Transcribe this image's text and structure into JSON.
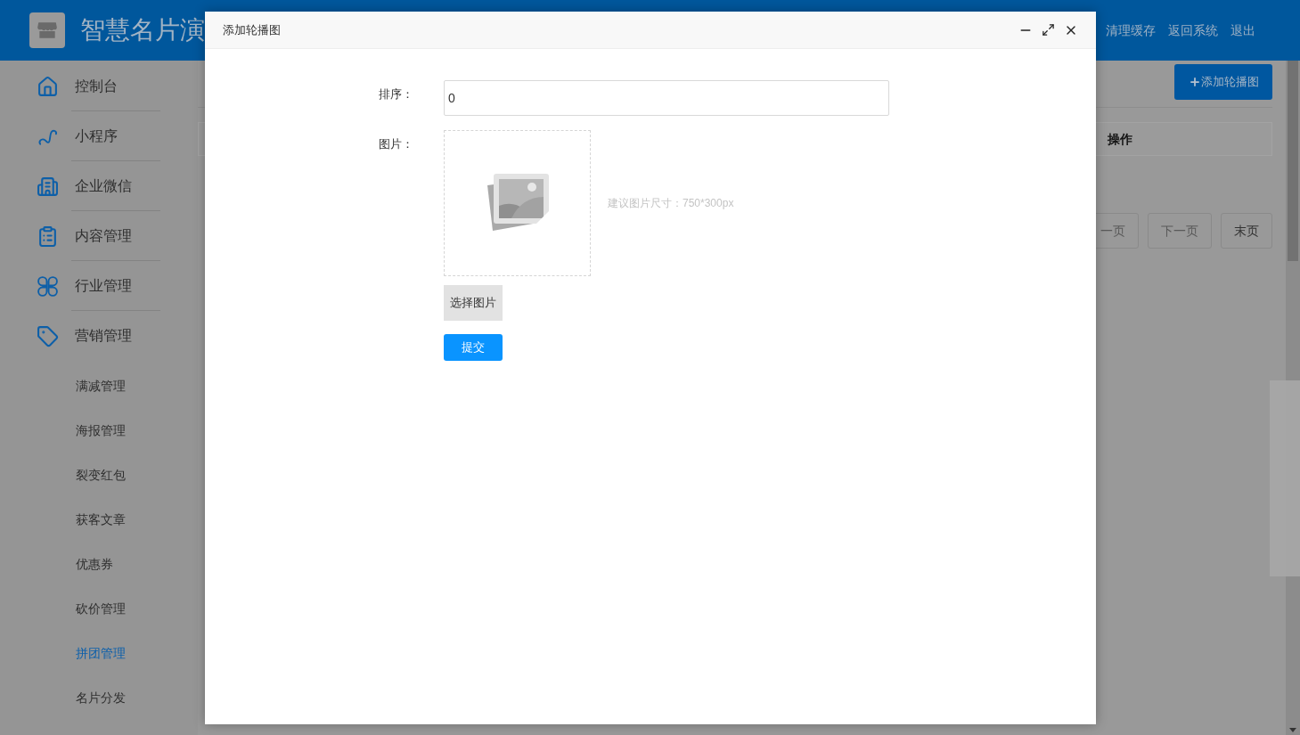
{
  "header": {
    "title": "智慧名片演",
    "links": [
      "清理缓存",
      "返回系统",
      "退出"
    ]
  },
  "sidebar": {
    "items": [
      {
        "label": "控制台",
        "kind": "menu",
        "selected": false
      },
      {
        "label": "小程序",
        "kind": "menu",
        "selected": false
      },
      {
        "label": "企业微信",
        "kind": "menu",
        "selected": false
      },
      {
        "label": "内容管理",
        "kind": "menu",
        "selected": false
      },
      {
        "label": "行业管理",
        "kind": "menu",
        "selected": false
      },
      {
        "label": "营销管理",
        "kind": "menu",
        "selected": false
      },
      {
        "label": "满减管理",
        "kind": "submenu",
        "selected": false
      },
      {
        "label": "海报管理",
        "kind": "submenu",
        "selected": false
      },
      {
        "label": "裂变红包",
        "kind": "submenu",
        "selected": false
      },
      {
        "label": "获客文章",
        "kind": "submenu",
        "selected": false
      },
      {
        "label": "优惠券",
        "kind": "submenu",
        "selected": false
      },
      {
        "label": "砍价管理",
        "kind": "submenu",
        "selected": false
      },
      {
        "label": "拼团管理",
        "kind": "submenu",
        "selected": true
      },
      {
        "label": "名片分发",
        "kind": "submenu",
        "selected": false
      }
    ]
  },
  "content": {
    "add_button": "添加轮播图",
    "table": {
      "columns": [
        "操作"
      ]
    },
    "pagination": [
      "一页",
      "下一页",
      "末页"
    ]
  },
  "modal": {
    "title": "添加轮播图",
    "sort": {
      "label": "排序：",
      "value": "0"
    },
    "image": {
      "label": "图片：",
      "hint": "建议图片尺寸：750*300px"
    },
    "choose_button": "选择图片",
    "submit_button": "提交"
  }
}
